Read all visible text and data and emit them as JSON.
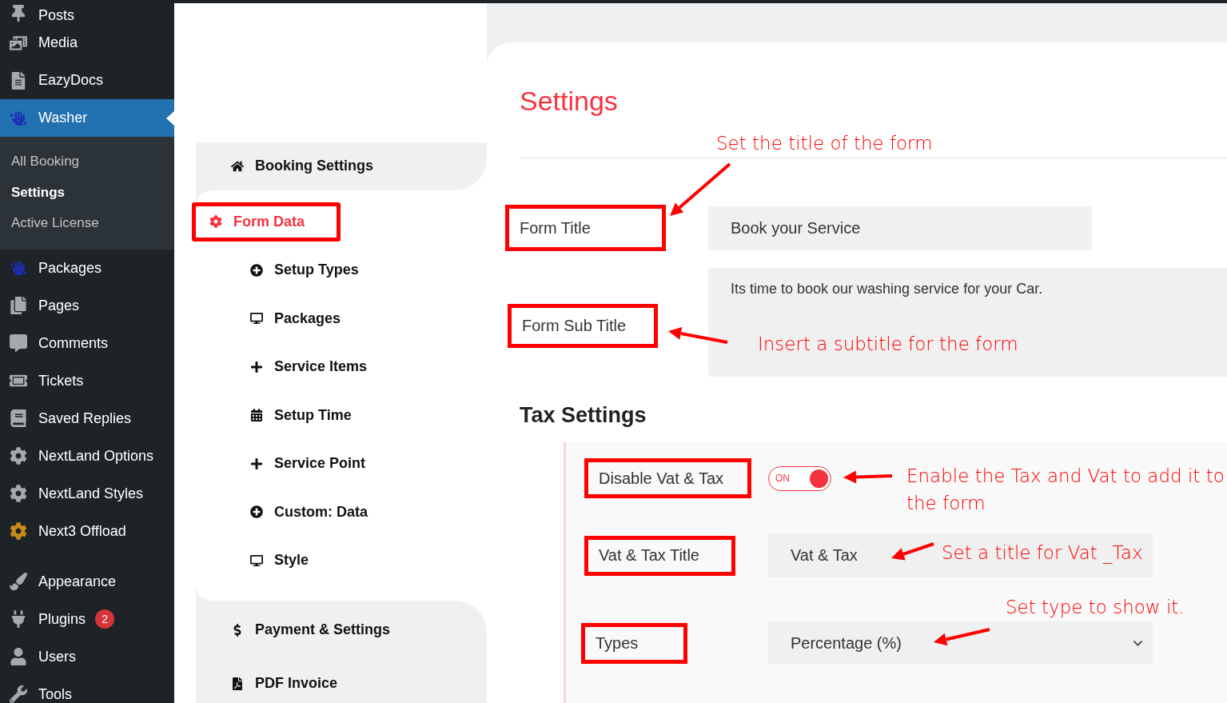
{
  "sidebar": {
    "items": [
      {
        "label": "Posts",
        "selected": false
      },
      {
        "label": "Media",
        "selected": false
      },
      {
        "label": "EazyDocs",
        "selected": false
      },
      {
        "label": "Washer",
        "selected": true,
        "children": [
          {
            "label": "All Booking",
            "selected": false
          },
          {
            "label": "Settings",
            "selected": true
          },
          {
            "label": "Active License",
            "selected": false
          }
        ]
      },
      {
        "label": "Packages",
        "selected": false
      },
      {
        "label": "Pages",
        "selected": false
      },
      {
        "label": "Comments",
        "selected": false
      },
      {
        "label": "Tickets",
        "selected": false
      },
      {
        "label": "Saved Replies",
        "selected": false
      },
      {
        "label": "NextLand Options",
        "selected": false
      },
      {
        "label": "NextLand Styles",
        "selected": false
      },
      {
        "label": "Next3 Offload",
        "selected": false
      },
      {
        "label": "Appearance",
        "selected": false
      },
      {
        "label": "Plugins",
        "selected": false,
        "badge": "2"
      },
      {
        "label": "Users",
        "selected": false
      },
      {
        "label": "Tools",
        "selected": false
      }
    ]
  },
  "settings_nav": {
    "items": [
      {
        "label": "Booking Settings",
        "selected": false,
        "highlighted": false
      },
      {
        "label": "Form Data",
        "selected": true,
        "highlighted": true,
        "children": [
          {
            "label": "Setup Types"
          },
          {
            "label": "Packages"
          },
          {
            "label": "Service Items"
          },
          {
            "label": "Setup Time"
          },
          {
            "label": "Service Point"
          },
          {
            "label": "Custom: Data"
          },
          {
            "label": "Style"
          }
        ]
      },
      {
        "label": "Payment & Settings",
        "selected": false,
        "highlighted": false
      },
      {
        "label": "PDF Invoice",
        "selected": false,
        "highlighted": false
      }
    ]
  },
  "content": {
    "title": "Settings",
    "fields": [
      {
        "label": "Form Title",
        "kind": "input",
        "highlighted": true,
        "value": "Book your Service"
      },
      {
        "label": "Form Sub Title",
        "kind": "textarea",
        "highlighted": true,
        "value": "Its time to book our washing service for your Car."
      }
    ],
    "tax_settings": {
      "heading": "Tax Settings",
      "fields": [
        {
          "label": "Disable Vat & Tax",
          "kind": "toggle",
          "highlighted": true,
          "on": true,
          "toggle_text": "ON"
        },
        {
          "label": "Vat & Tax Title",
          "kind": "input",
          "highlighted": true,
          "value": "Vat & Tax"
        },
        {
          "label": "Types",
          "kind": "select",
          "highlighted": true,
          "value": "Percentage (%)"
        }
      ]
    }
  },
  "annotations": [
    {
      "text": "Set the title of the form"
    },
    {
      "text": "Insert a subtitle for the form"
    },
    {
      "text": "Enable the Tax and Vat to add it to the form"
    },
    {
      "text": "Set a title for Vat _Tax"
    },
    {
      "text": "Set type to show it."
    }
  ]
}
